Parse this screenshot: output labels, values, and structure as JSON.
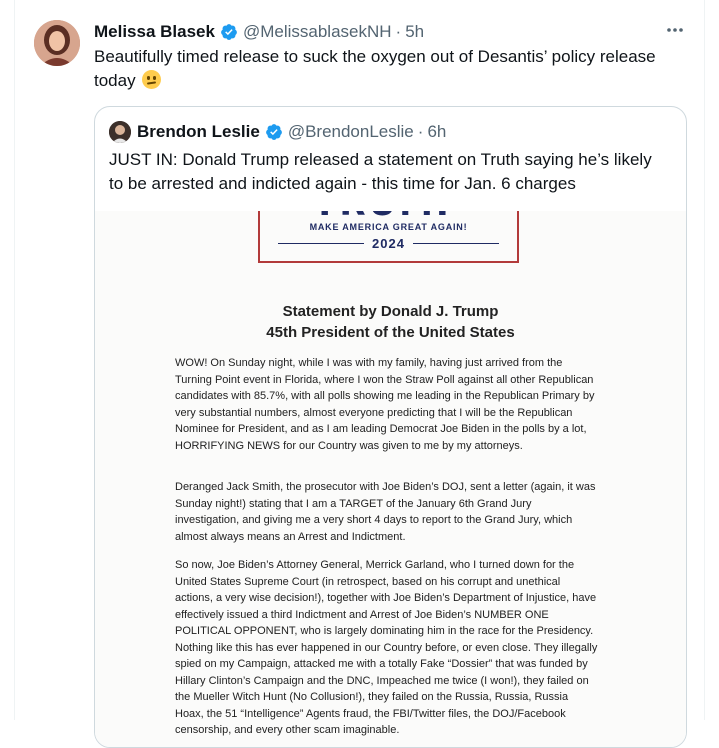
{
  "tweet": {
    "author_name": "Melissa Blasek",
    "handle": "@MelissablasekNH",
    "separator": "·",
    "time": "5h",
    "more_icon": "more-horizontal-icon",
    "text": "Beautifully timed release to suck the oxygen out of Desantis’ policy release today",
    "emoji": "worried-face-emoji"
  },
  "quoted_tweet": {
    "author_name": "Brendon Leslie",
    "handle": "@BrendonLeslie",
    "separator": "·",
    "time": "6h",
    "text": "JUST IN: Donald Trump released a statement on Truth saying he’s likely to be arrested and indicted again - this time for Jan. 6 charges"
  },
  "document": {
    "logo_word": "TRUMP",
    "logo_slogan": "MAKE AMERICA GREAT AGAIN!",
    "logo_year": "2024",
    "title_line1": "Statement by Donald J. Trump",
    "title_line2": "45th President of the United States",
    "paragraph1": "WOW! On Sunday night, while I was with my family, having just arrived from the Turning Point event in Florida, where I won the Straw Poll against all other Republican candidates with 85.7%, with all polls showing me leading in the Republican Primary by very substantial numbers, almost everyone predicting that I will be the Republican Nominee for President, and as I am leading Democrat Joe Biden in the polls by a lot, HORRIFYING NEWS for our Country was given to me by my attorneys.",
    "paragraph2": "Deranged Jack Smith, the prosecutor with Joe Biden’s DOJ, sent a letter (again, it was Sunday night!) stating that I am a TARGET of the January 6th Grand Jury investigation, and giving me a very short 4 days to report to the Grand Jury, which almost always means an Arrest and Indictment.",
    "paragraph3": "So now, Joe Biden’s Attorney General, Merrick Garland, who I turned down for the United States Supreme Court (in retrospect, based on his corrupt and unethical actions, a very wise decision!), together with Joe Biden’s Department of Injustice, have effectively issued a third Indictment and Arrest of Joe Biden’s NUMBER ONE POLITICAL OPPONENT, who is largely dominating him in the race for the Presidency. Nothing like this has ever happened in our Country before, or even close. They illegally spied on my Campaign, attacked me with a totally Fake “Dossier” that was funded by Hillary Clinton’s Campaign and the DNC, Impeached me twice (I won!), they failed on the Mueller Witch Hunt (No Collusion!), they failed on the Russia, Russia, Russia Hoax, the 51 “Intelligence” Agents fraud, the FBI/Twitter files, the DOJ/Facebook censorship, and every other scam imaginable."
  },
  "colors": {
    "verified": "#1d9bf0",
    "muted": "#536471",
    "border": "#cfd9de",
    "logo_navy": "#1f2b63",
    "logo_red": "#b23a3a"
  }
}
